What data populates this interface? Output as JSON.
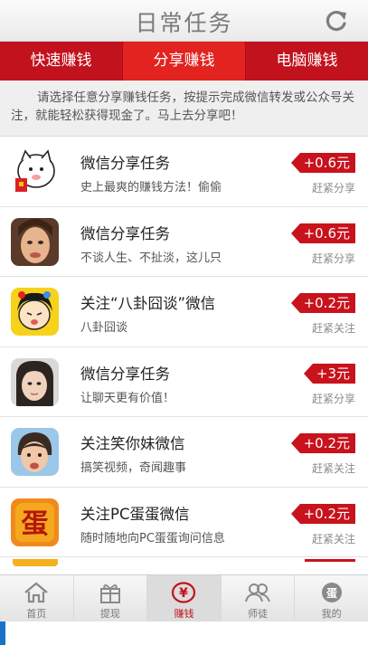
{
  "header": {
    "title": "日常任务",
    "refresh_icon": "refresh-icon"
  },
  "tabs": [
    {
      "label": "快速赚钱",
      "active": false
    },
    {
      "label": "分享赚钱",
      "active": true
    },
    {
      "label": "电脑赚钱",
      "active": false
    }
  ],
  "notice": {
    "text": "请选择任意分享赚钱任务，按提示完成微信转发或公众号关注，就能轻松获得现金了。马上去分享吧！"
  },
  "tasks": [
    {
      "title": "微信分享任务",
      "subtitle": "史上最爽的赚钱方法！偷偷",
      "reward": "+0.6元",
      "action": "赶紧分享",
      "thumb": "cartoon-cat"
    },
    {
      "title": "微信分享任务",
      "subtitle": "不谈人生、不扯淡，这儿只",
      "reward": "+0.6元",
      "action": "赶紧分享",
      "thumb": "woman-face"
    },
    {
      "title": "关注“八卦囧谈”微信",
      "subtitle": "八卦囧谈",
      "reward": "+0.2元",
      "action": "赶紧关注",
      "thumb": "cartoon-girl"
    },
    {
      "title": "微信分享任务",
      "subtitle": "让聊天更有价值！",
      "reward": "+3元",
      "action": "赶紧分享",
      "thumb": "girl-photo"
    },
    {
      "title": "关注笑你妹微信",
      "subtitle": "搞笑视频，奇闻趣事",
      "reward": "+0.2元",
      "action": "赶紧关注",
      "thumb": "funny-kid"
    },
    {
      "title": "关注PC蛋蛋微信",
      "subtitle": "随时随地向PC蛋蛋询问信息",
      "reward": "+0.2元",
      "action": "赶紧关注",
      "thumb": "pc-egg-logo"
    }
  ],
  "tabbar": [
    {
      "label": "首页",
      "icon": "home-icon",
      "active": false
    },
    {
      "label": "提现",
      "icon": "gift-icon",
      "active": false
    },
    {
      "label": "赚钱",
      "icon": "yen-icon",
      "active": true
    },
    {
      "label": "师徒",
      "icon": "people-icon",
      "active": false
    },
    {
      "label": "我的",
      "icon": "egg-profile-icon",
      "active": false
    }
  ],
  "colors": {
    "accent": "#e2231f",
    "tab_dark": "#c2121e",
    "reward": "#c8121c"
  }
}
